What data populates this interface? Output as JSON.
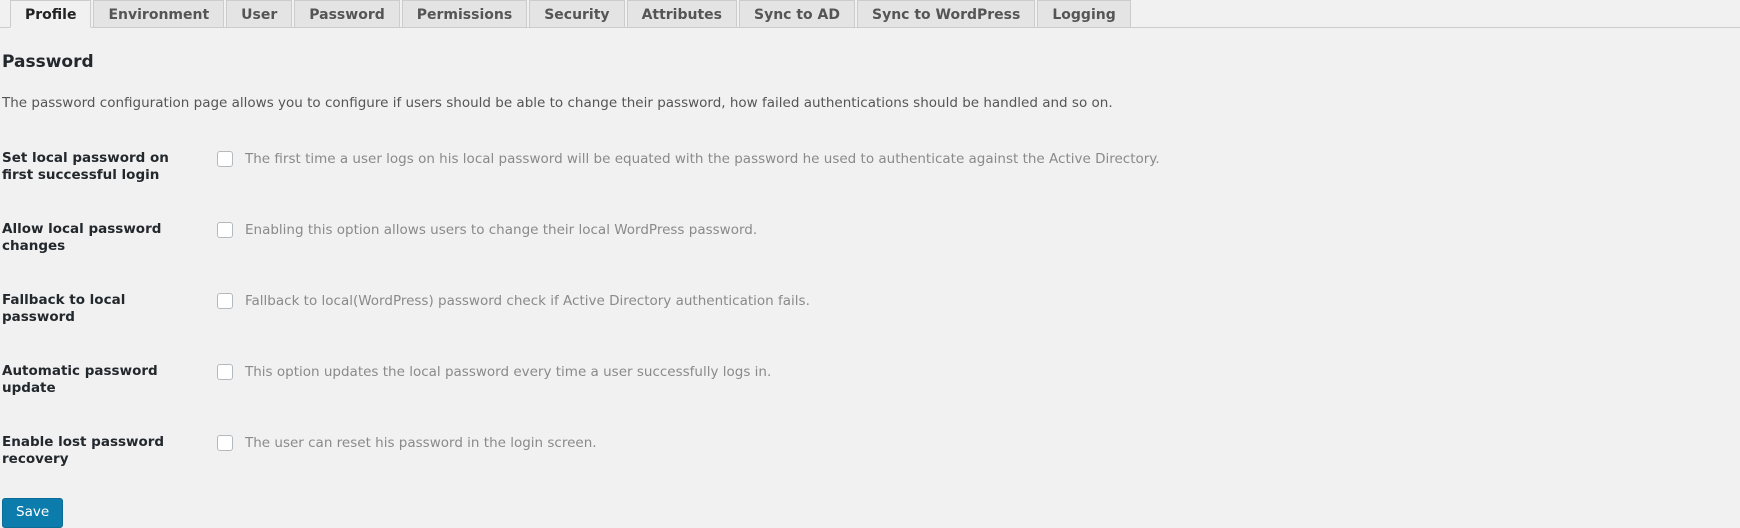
{
  "tabs": [
    {
      "label": "Profile",
      "active": true
    },
    {
      "label": "Environment",
      "active": false
    },
    {
      "label": "User",
      "active": false
    },
    {
      "label": "Password",
      "active": false
    },
    {
      "label": "Permissions",
      "active": false
    },
    {
      "label": "Security",
      "active": false
    },
    {
      "label": "Attributes",
      "active": false
    },
    {
      "label": "Sync to AD",
      "active": false
    },
    {
      "label": "Sync to WordPress",
      "active": false
    },
    {
      "label": "Logging",
      "active": false
    }
  ],
  "page": {
    "title": "Password",
    "description": "The password configuration page allows you to configure if users should be able to change their password, how failed authentications should be handled and so on."
  },
  "settings": [
    {
      "label": "Set local password on first successful login",
      "description": "The first time a user logs on his local password will be equated with the password he used to authenticate against the Active Directory.",
      "checked": false
    },
    {
      "label": "Allow local password changes",
      "description": "Enabling this option allows users to change their local WordPress password.",
      "checked": false
    },
    {
      "label": "Fallback to local password",
      "description": "Fallback to local(WordPress) password check if Active Directory authentication fails.",
      "checked": false
    },
    {
      "label": "Automatic password update",
      "description": "This option updates the local password every time a user successfully logs in.",
      "checked": false
    },
    {
      "label": "Enable lost password recovery",
      "description": "The user can reset his password in the login screen.",
      "checked": false
    }
  ],
  "actions": {
    "save_label": "Save"
  },
  "colors": {
    "accent": "#0c7cad",
    "page_background": "#f1f1f1",
    "tab_background": "#e4e4e4",
    "border": "#cccccc",
    "label_text": "#23282d",
    "description_text": "#8a8a8a"
  }
}
